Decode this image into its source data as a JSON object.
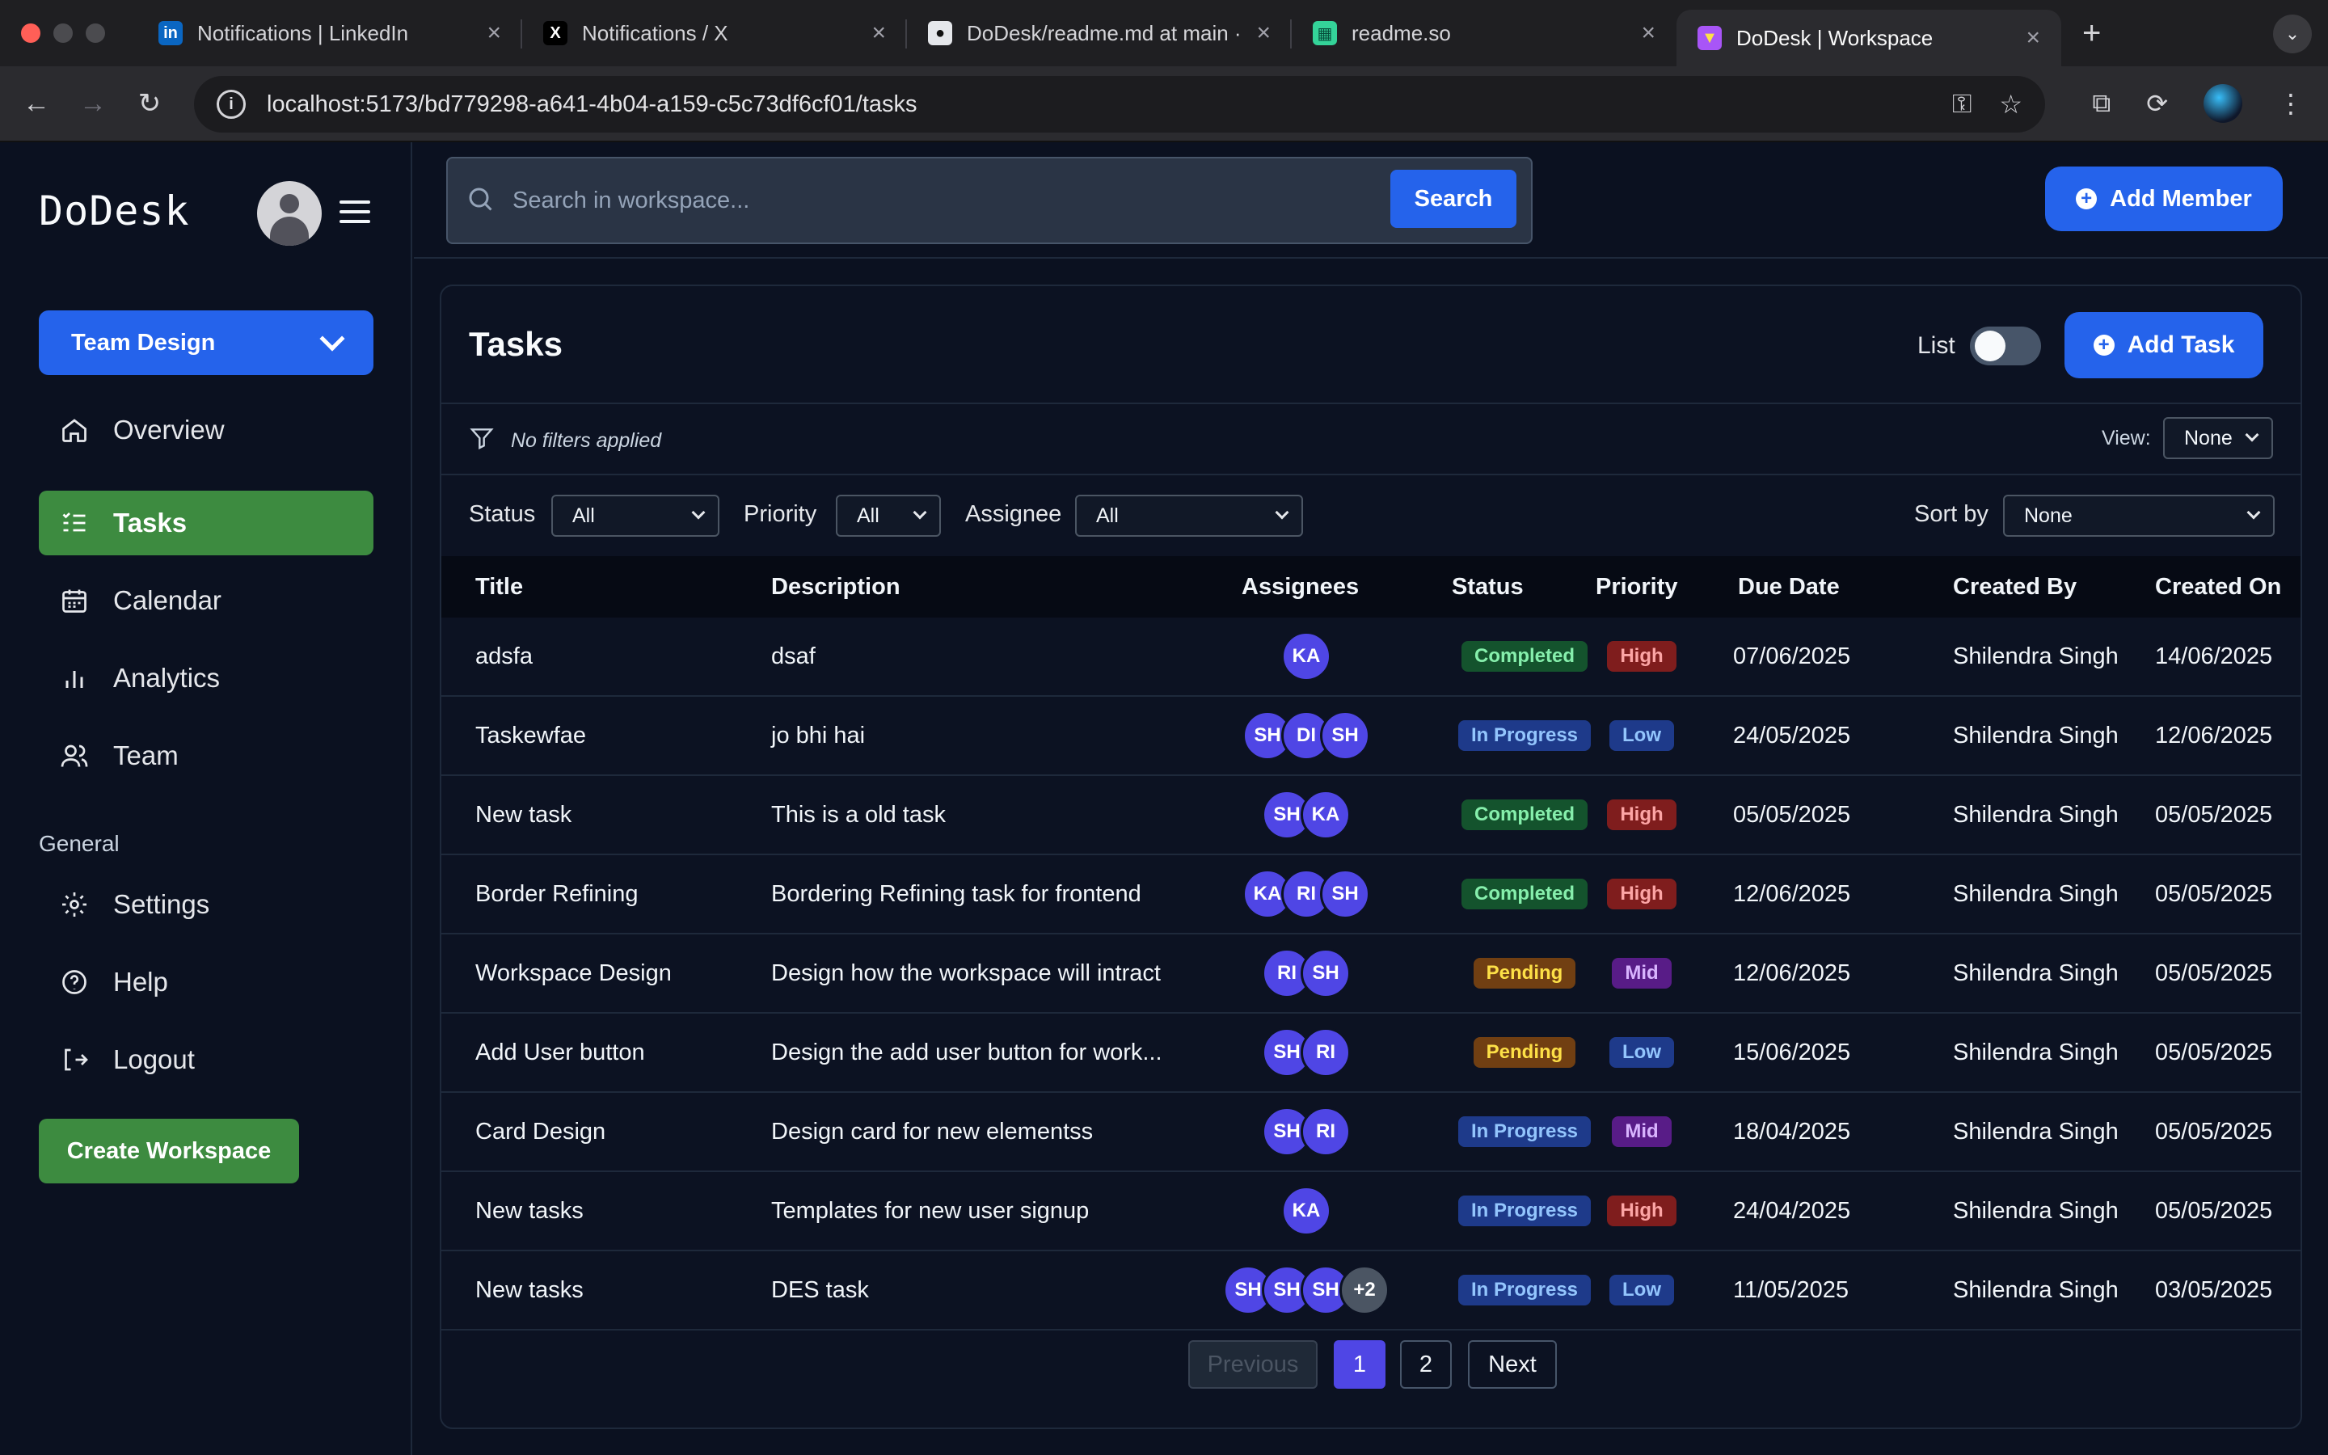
{
  "browser": {
    "tabs": [
      {
        "title": "Notifications | LinkedIn",
        "favicon": "linkedin-icon",
        "active": false
      },
      {
        "title": "Notifications / X",
        "favicon": "x-icon",
        "active": false
      },
      {
        "title": "DoDesk/readme.md at main · ",
        "favicon": "github-icon",
        "active": false
      },
      {
        "title": "readme.so",
        "favicon": "readme-icon",
        "active": false
      },
      {
        "title": "DoDesk | Workspace",
        "favicon": "vite-icon",
        "active": true
      }
    ],
    "url": "localhost:5173/bd779298-a641-4b04-a159-c5c73df6cf01/tasks"
  },
  "sidebar": {
    "brand": "DoDesk",
    "team": "Team Design",
    "nav": [
      {
        "label": "Overview",
        "icon": "home-icon",
        "active": false
      },
      {
        "label": "Tasks",
        "icon": "task-list-icon",
        "active": true
      },
      {
        "label": "Calendar",
        "icon": "calendar-icon",
        "active": false
      },
      {
        "label": "Analytics",
        "icon": "bar-chart-icon",
        "active": false
      },
      {
        "label": "Team",
        "icon": "users-icon",
        "active": false
      }
    ],
    "general_label": "General",
    "general": [
      {
        "label": "Settings",
        "icon": "gear-icon"
      },
      {
        "label": "Help",
        "icon": "help-circle-icon"
      },
      {
        "label": "Logout",
        "icon": "logout-icon"
      }
    ],
    "create_workspace": "Create Workspace"
  },
  "topbar": {
    "search_placeholder": "Search in workspace...",
    "search_button": "Search",
    "add_member": "Add Member"
  },
  "tasks": {
    "title": "Tasks",
    "list_label": "List",
    "list_on": false,
    "add_task": "Add Task",
    "filter_note": "No filters applied",
    "view_label": "View:",
    "view_value": "None",
    "filters": {
      "status_label": "Status",
      "status_value": "All",
      "priority_label": "Priority",
      "priority_value": "All",
      "assignee_label": "Assignee",
      "assignee_value": "All",
      "sort_label": "Sort by",
      "sort_value": "None"
    },
    "columns": [
      "Title",
      "Description",
      "Assignees",
      "Status",
      "Priority",
      "Due Date",
      "Created By",
      "Created On"
    ],
    "rows": [
      {
        "title": "adsfa",
        "description": "dsaf",
        "assignees": [
          "KA"
        ],
        "status": "Completed",
        "priority": "High",
        "due": "07/06/2025",
        "created_by": "Shilendra Singh",
        "created_on": "14/06/2025"
      },
      {
        "title": "Taskewfae",
        "description": "jo bhi hai",
        "assignees": [
          "SH",
          "DI",
          "SH"
        ],
        "status": "In Progress",
        "priority": "Low",
        "due": "24/05/2025",
        "created_by": "Shilendra Singh",
        "created_on": "12/06/2025"
      },
      {
        "title": "New task",
        "description": "This is a old task",
        "assignees": [
          "SH",
          "KA"
        ],
        "status": "Completed",
        "priority": "High",
        "due": "05/05/2025",
        "created_by": "Shilendra Singh",
        "created_on": "05/05/2025"
      },
      {
        "title": "Border Refining",
        "description": "Bordering Refining task for frontend",
        "assignees": [
          "KA",
          "RI",
          "SH"
        ],
        "status": "Completed",
        "priority": "High",
        "due": "12/06/2025",
        "created_by": "Shilendra Singh",
        "created_on": "05/05/2025"
      },
      {
        "title": "Workspace Design",
        "description": "Design how the workspace will intract",
        "assignees": [
          "RI",
          "SH"
        ],
        "status": "Pending",
        "priority": "Mid",
        "due": "12/06/2025",
        "created_by": "Shilendra Singh",
        "created_on": "05/05/2025"
      },
      {
        "title": "Add User button",
        "description": "Design the add user button for work...",
        "assignees": [
          "SH",
          "RI"
        ],
        "status": "Pending",
        "priority": "Low",
        "due": "15/06/2025",
        "created_by": "Shilendra Singh",
        "created_on": "05/05/2025"
      },
      {
        "title": "Card Design",
        "description": "Design card for new elementss",
        "assignees": [
          "SH",
          "RI"
        ],
        "status": "In Progress",
        "priority": "Mid",
        "due": "18/04/2025",
        "created_by": "Shilendra Singh",
        "created_on": "05/05/2025"
      },
      {
        "title": "New tasks",
        "description": "Templates for new user signup",
        "assignees": [
          "KA"
        ],
        "status": "In Progress",
        "priority": "High",
        "due": "24/04/2025",
        "created_by": "Shilendra Singh",
        "created_on": "05/05/2025"
      },
      {
        "title": "New tasks",
        "description": "DES task",
        "assignees": [
          "SH",
          "SH",
          "SH",
          "+2"
        ],
        "status": "In Progress",
        "priority": "Low",
        "due": "11/05/2025",
        "created_by": "Shilendra Singh",
        "created_on": "03/05/2025"
      }
    ],
    "pagination": {
      "previous": "Previous",
      "pages": [
        "1",
        "2"
      ],
      "current": "1",
      "next": "Next"
    }
  },
  "colors": {
    "accent": "#2563eb",
    "active_nav": "#3d8b40",
    "avatar": "#4f46e5"
  }
}
